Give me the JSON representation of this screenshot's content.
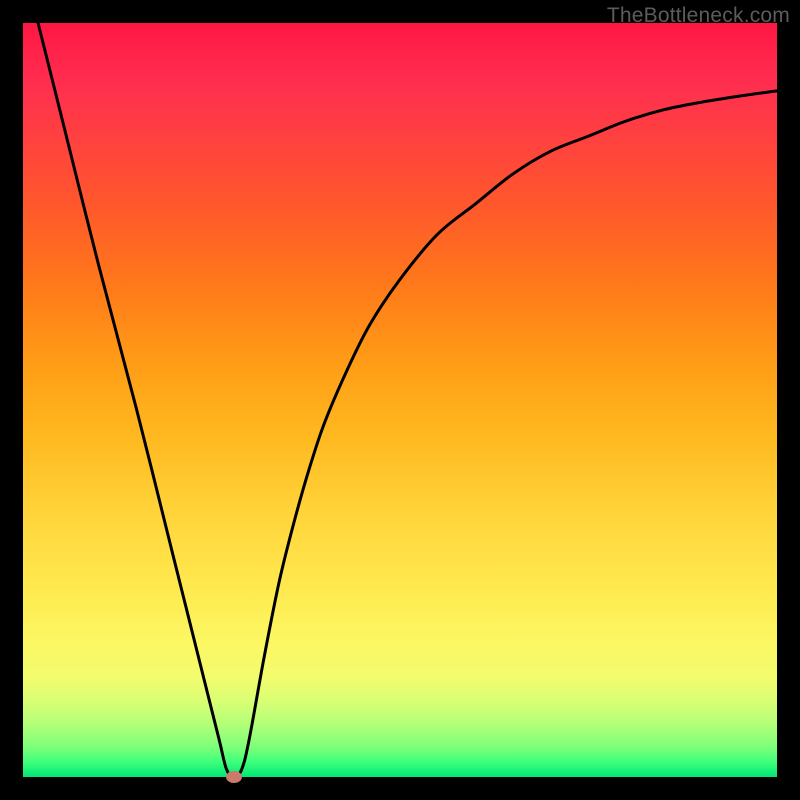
{
  "watermark": "TheBottleneck.com",
  "accent_marker_color": "#c97a6a",
  "chart_data": {
    "type": "line",
    "title": "",
    "xlabel": "",
    "ylabel": "",
    "xlim": [
      0,
      100
    ],
    "ylim": [
      0,
      100
    ],
    "grid": false,
    "background_gradient": {
      "top": "#ff1744",
      "middle": "#ffd43a",
      "bottom": "#00e676"
    },
    "series": [
      {
        "name": "bottleneck-curve",
        "x": [
          2,
          5,
          10,
          15,
          20,
          24,
          26,
          27,
          28,
          29,
          30,
          32,
          34,
          36,
          38,
          40,
          43,
          46,
          50,
          55,
          60,
          65,
          70,
          75,
          80,
          85,
          90,
          95,
          100
        ],
        "y": [
          100,
          88,
          68,
          49,
          29,
          13,
          5,
          1,
          0,
          1,
          5,
          16,
          26,
          34,
          41,
          47,
          54,
          60,
          66,
          72,
          76,
          80,
          83,
          85,
          87,
          88.5,
          89.5,
          90.3,
          91
        ]
      }
    ],
    "minimum_point": {
      "x": 28,
      "y": 0
    }
  }
}
